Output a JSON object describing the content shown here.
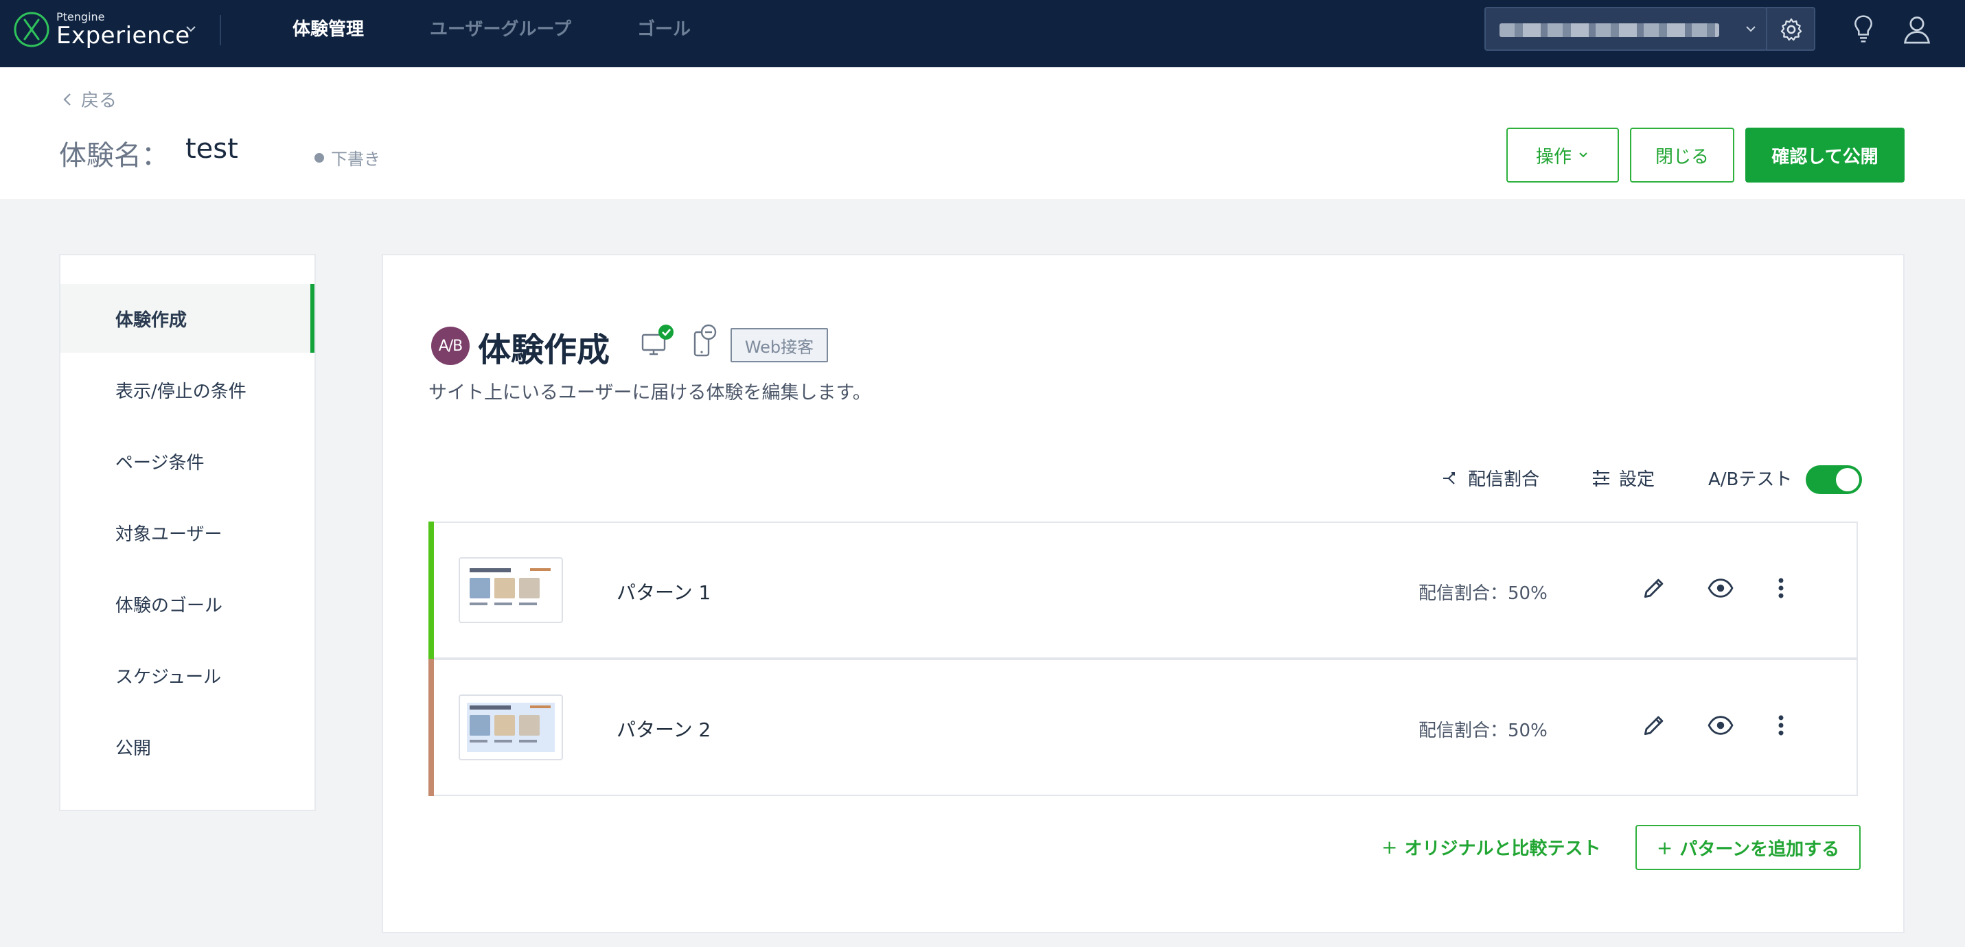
{
  "topbar": {
    "logo_small": "Ptengine",
    "logo_big": "Experience",
    "nav": [
      "体験管理",
      "ユーザーグループ",
      "ゴール"
    ],
    "active_nav": "体験管理"
  },
  "header": {
    "back_label": "戻る",
    "title_label": "体験名：",
    "title_value": "test",
    "status": "下書き",
    "operations_label": "操作",
    "close_label": "閉じる",
    "publish_label": "確認して公開"
  },
  "sidebar": {
    "items": [
      "体験作成",
      "表示/停止の条件",
      "ページ条件",
      "対象ユーザー",
      "体験のゴール",
      "スケジュール",
      "公開"
    ],
    "active": "体験作成"
  },
  "main": {
    "ab_badge": "A/B",
    "title": "体験作成",
    "web_tag": "Web接客",
    "description": "サイト上にいるユーザーに届ける体験を編集します。",
    "toolbar": {
      "distribution_label": "配信割合",
      "settings_label": "設定",
      "ab_test_label": "A/Bテスト",
      "ab_test_enabled": true
    },
    "patterns": [
      {
        "name": "パターン 1",
        "ratio": "配信割合：50%",
        "accent": "#52c41a"
      },
      {
        "name": "パターン 2",
        "ratio": "配信割合：50%",
        "accent": "#c58a6e"
      }
    ],
    "add_compare_label": "オリジナルと比較テスト",
    "add_pattern_label": "パターンを追加する"
  },
  "colors": {
    "topbar_bg": "#0f2340",
    "brand_green": "#14a33a",
    "ab_badge_bg": "#7c3f6a"
  }
}
